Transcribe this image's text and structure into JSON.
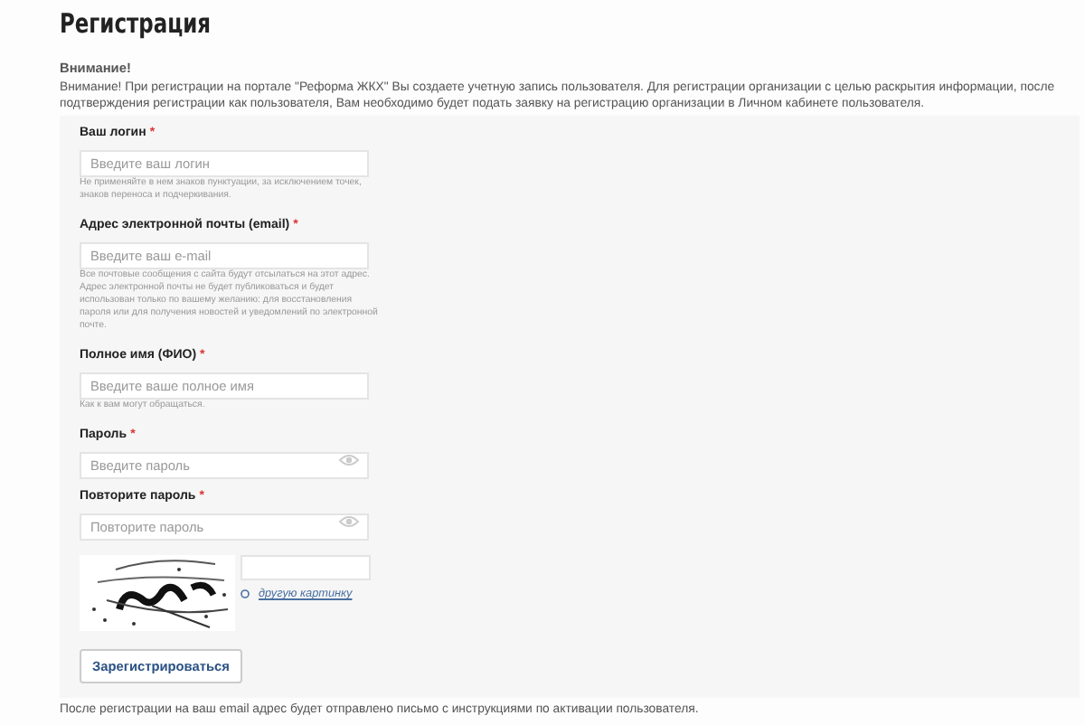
{
  "title": "Регистрация",
  "notice": {
    "heading": "Внимание!",
    "text": "Внимание! При регистрации на портале \"Реформа ЖКХ\" Вы создаете учетную запись пользователя. Для регистрации организации с целью раскрытия информации, после подтверждения регистрации как пользователя, Вам необходимо будет подать заявку на регистрацию организации в Личном кабинете пользователя."
  },
  "fields": [
    {
      "kind": "text",
      "label": "Ваш логин",
      "required_mark": "*",
      "placeholder": "Введите ваш логин",
      "hint": "Не применяйте в нем знаков пунктуации, за исключением точек, знаков переноса и подчеркивания."
    },
    {
      "kind": "text",
      "label": "Адрес электронной почты (email)",
      "required_mark": "*",
      "placeholder": "Введите ваш e-mail",
      "hint": "Все почтовые сообщения с сайта будут отсылаться на этот адрес. Адрес электронной почты не будет публиковаться и будет использован только по вашему желанию: для восстановления пароля или для получения новостей и уведомлений по электронной почте."
    },
    {
      "kind": "text",
      "label": "Полное имя (ФИО)",
      "required_mark": "*",
      "placeholder": "Введите ваше полное имя",
      "hint": "Как к вам могут обращаться."
    },
    {
      "kind": "password",
      "label": "Пароль",
      "required_mark": "*",
      "placeholder": "Введите пароль"
    },
    {
      "kind": "password",
      "label": "Повторите пароль",
      "required_mark": "*",
      "placeholder": "Повторите пароль"
    }
  ],
  "captcha": {
    "refresh_link": "другую картинку"
  },
  "submit": "Зарегистрироваться",
  "footer": "После регистрации на ваш email адрес будет отправлено письмо с инструкциями по активации пользователя."
}
